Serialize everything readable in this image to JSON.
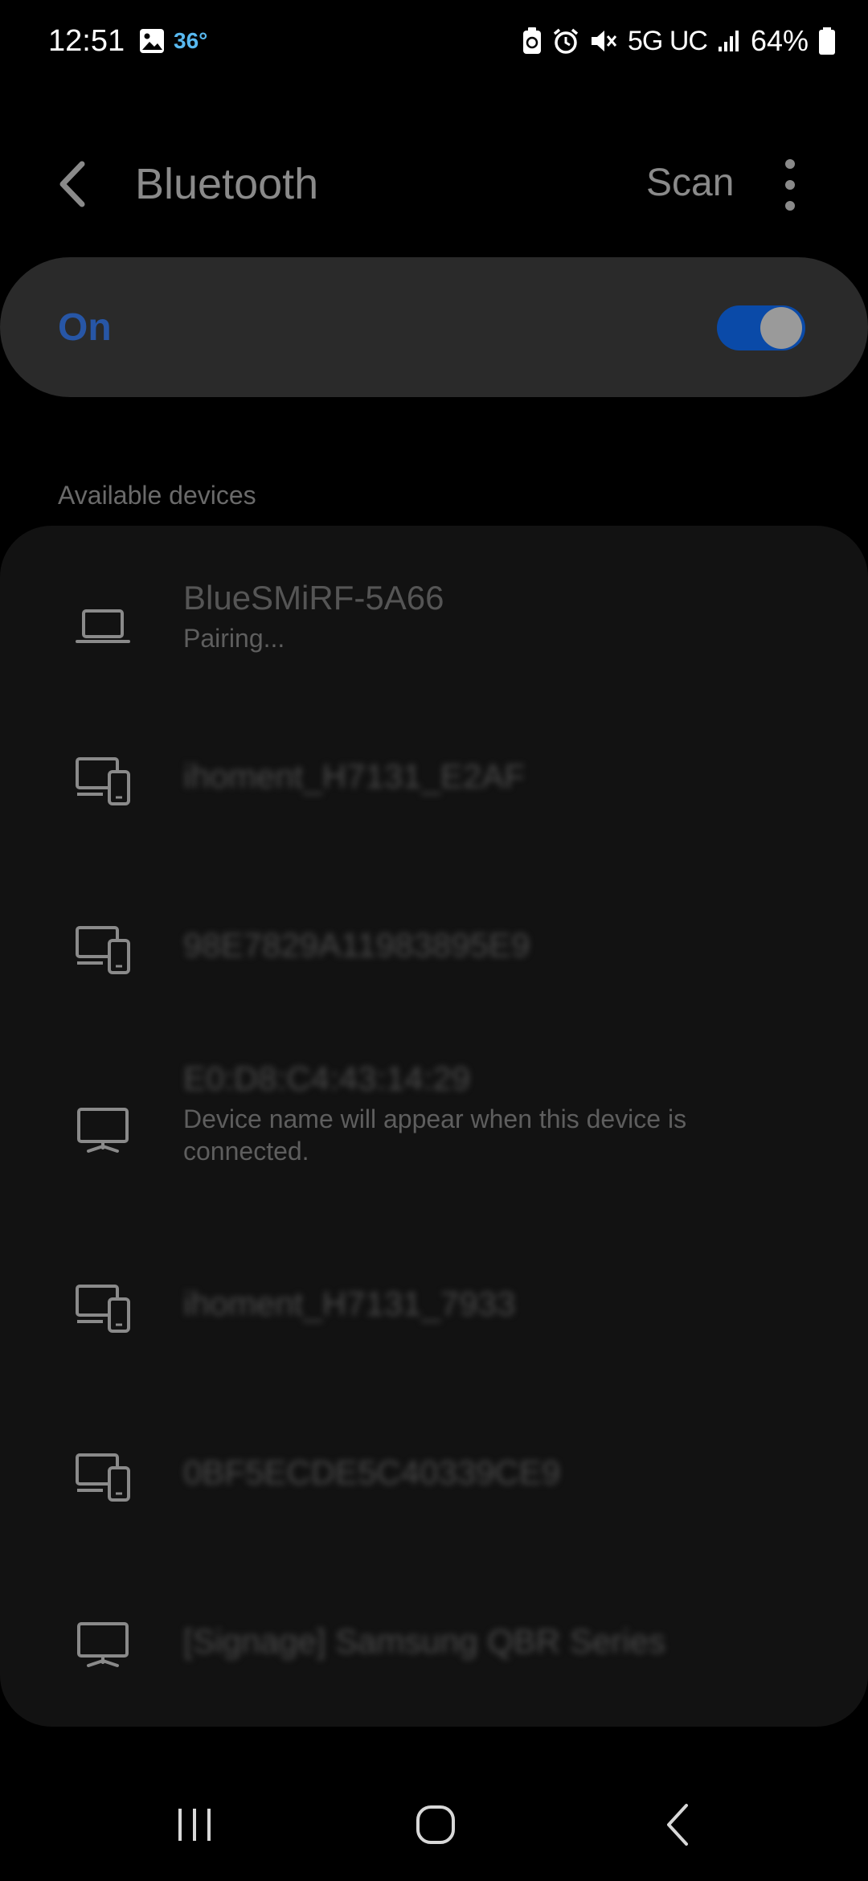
{
  "status_bar": {
    "time": "12:51",
    "temperature": "36°",
    "network": "5G UC",
    "battery": "64%",
    "left_icons": [
      "image-icon"
    ],
    "right_icons": [
      "battery-saver-icon",
      "alarm-icon",
      "mute-icon",
      "signal-icon",
      "battery-icon"
    ]
  },
  "header": {
    "title": "Bluetooth",
    "scan_label": "Scan"
  },
  "toggle": {
    "label": "On",
    "state": true,
    "accent_color": "#0a4aa8"
  },
  "section": {
    "available_label": "Available devices"
  },
  "devices": [
    {
      "name": "BlueSMiRF-5A66",
      "status": "Pairing...",
      "icon": "laptop-icon",
      "blurred": false
    },
    {
      "name": "ihoment_H7131_E2AF",
      "status": "",
      "icon": "devices-icon",
      "blurred": true
    },
    {
      "name": "98E7829A11983895E9",
      "status": "",
      "icon": "devices-icon",
      "blurred": true
    },
    {
      "name": "E0:D8:C4:43:14:29",
      "status": "Device name will appear when this device is connected.",
      "icon": "monitor-icon",
      "blurred": true
    },
    {
      "name": "ihoment_H7131_7933",
      "status": "",
      "icon": "devices-icon",
      "blurred": true
    },
    {
      "name": "0BF5ECDE5C40339CE9",
      "status": "",
      "icon": "devices-icon",
      "blurred": true
    },
    {
      "name": "[Signage] Samsung QBR Series",
      "status": "",
      "icon": "monitor-icon",
      "blurred": true
    }
  ],
  "navbar": {
    "buttons": [
      "recents-icon",
      "home-icon",
      "back-icon"
    ]
  }
}
